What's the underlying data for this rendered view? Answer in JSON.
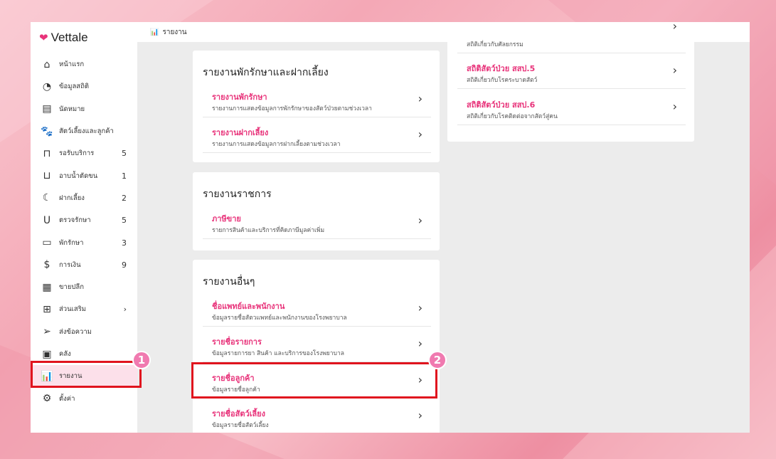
{
  "brand": {
    "name": "Vettale"
  },
  "topbar": {
    "title": "รายงาน"
  },
  "sidebar": {
    "items": [
      {
        "label": "หน้าแรก",
        "icon": "home-icon",
        "count": ""
      },
      {
        "label": "ข้อมูลสถิติ",
        "icon": "dashboard-icon",
        "count": ""
      },
      {
        "label": "นัดหมาย",
        "icon": "calendar-icon",
        "count": ""
      },
      {
        "label": "สัตว์เลี้ยงและลูกค้า",
        "icon": "paw-icon",
        "count": ""
      },
      {
        "label": "รอรับบริการ",
        "icon": "sofa-icon",
        "count": "5"
      },
      {
        "label": "อาบน้ำตัดขน",
        "icon": "bathtub-icon",
        "count": "1"
      },
      {
        "label": "ฝากเลี้ยง",
        "icon": "moon-icon",
        "count": "2"
      },
      {
        "label": "ตรวจรักษา",
        "icon": "stethoscope-icon",
        "count": "5"
      },
      {
        "label": "พักรักษา",
        "icon": "bed-icon",
        "count": "3"
      },
      {
        "label": "การเงิน",
        "icon": "money-hand-icon",
        "count": "9"
      },
      {
        "label": "ขายปลีก",
        "icon": "cash-register-icon",
        "count": ""
      },
      {
        "label": "ส่วนเสริม",
        "icon": "plus-box-icon",
        "count": "›"
      },
      {
        "label": "ส่งข้อความ",
        "icon": "send-icon",
        "count": ""
      },
      {
        "label": "คลัง",
        "icon": "inventory-box-icon",
        "count": ""
      },
      {
        "label": "รายงาน",
        "icon": "bar-chart-icon",
        "count": ""
      },
      {
        "label": "ตั้งค่า",
        "icon": "gear-icon",
        "count": ""
      }
    ]
  },
  "cards": {
    "boarding": {
      "title": "รายงานพักรักษาและฝากเลี้ยง",
      "rows": [
        {
          "title": "รายงานพักรักษา",
          "sub": "รายงานการแสดงข้อมูลการพักรักษาของสัตว์ป่วยตามช่วงเวลา"
        },
        {
          "title": "รายงานฝากเลี้ยง",
          "sub": "รายงานการแสดงข้อมูลการฝากเลี้ยงตามช่วงเวลา"
        }
      ]
    },
    "gov": {
      "title": "รายงานราชการ",
      "rows": [
        {
          "title": "ภาษีขาย",
          "sub": "รายการสินค้าและบริการที่คิดภาษีมูลค่าเพิ่ม"
        }
      ]
    },
    "other": {
      "title": "รายงานอื่นๆ",
      "rows": [
        {
          "title": "ชื่อแพทย์และพนักงาน",
          "sub": "ข้อมูลรายชื่อสัตวแพทย์และพนักงานของโรงพยาบาล"
        },
        {
          "title": "รายชื่อรายการ",
          "sub": "ข้อมูลรายการยา สินค้า และบริการของโรงพยาบาล"
        },
        {
          "title": "รายชื่อลูกค้า",
          "sub": "ข้อมูลรายชื่อลูกค้า"
        },
        {
          "title": "รายชื่อสัตว์เลี้ยง",
          "sub": "ข้อมูลรายชื่อสัตว์เลี้ยง"
        }
      ]
    },
    "stats": {
      "top_sub": "สถิติเกี่ยวกับศัลยกรรม",
      "rows": [
        {
          "title": "สถิติสัตว์ป่วย สสป.5",
          "sub": "สถิติเกี่ยวกับโรคระบาดสัตว์"
        },
        {
          "title": "สถิติสัตว์ป่วย สสป.6",
          "sub": "สถิติเกี่ยวกับโรคติดต่อจากสัตว์สู่คน"
        }
      ]
    }
  },
  "badges": {
    "one": "1",
    "two": "2"
  },
  "colors": {
    "accent": "#e8337a",
    "highlight": "#e0141e",
    "badge": "#f07ab0"
  }
}
